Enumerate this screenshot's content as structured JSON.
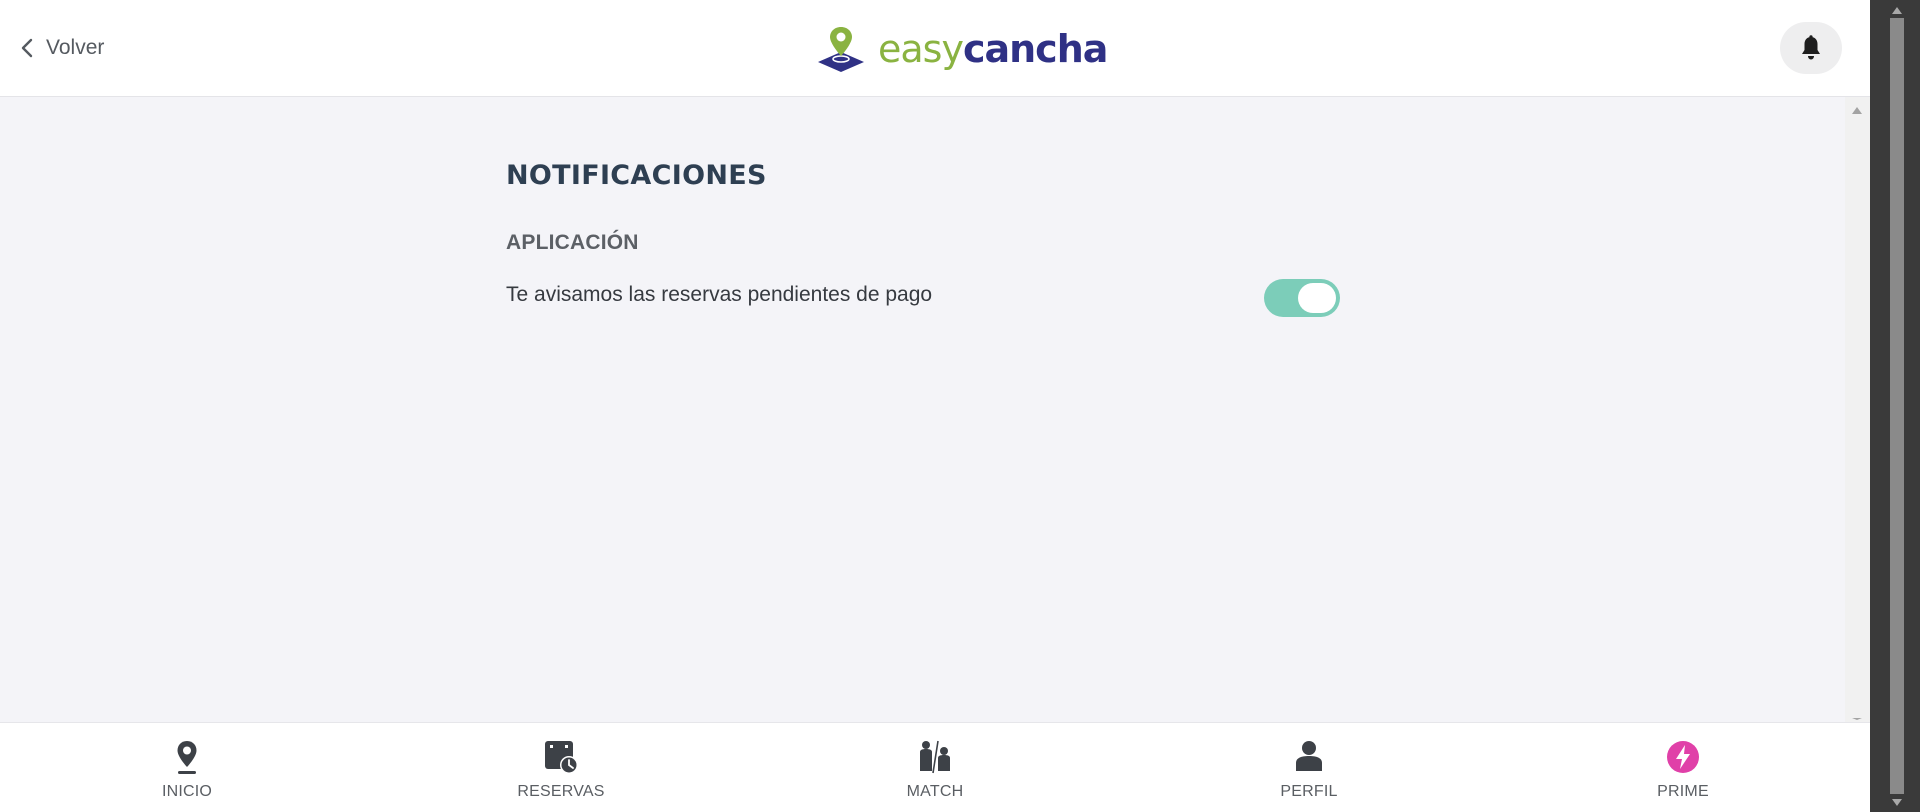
{
  "header": {
    "back_label": "Volver",
    "logo": {
      "easy": "easy",
      "cancha": "cancha",
      "icon": "map-pin-icon"
    },
    "notifications_icon": "bell-icon"
  },
  "main": {
    "title": "NOTIFICACIONES",
    "section_title": "APLICACIÓN",
    "settings": [
      {
        "label": "Te avisamos las reservas pendientes de pago",
        "enabled": true
      }
    ]
  },
  "bottom_nav": {
    "items": [
      {
        "label": "INICIO",
        "icon": "location-pin-icon"
      },
      {
        "label": "RESERVAS",
        "icon": "calendar-clock-icon"
      },
      {
        "label": "MATCH",
        "icon": "players-icon"
      },
      {
        "label": "PERFIL",
        "icon": "user-icon"
      },
      {
        "label": "PRIME",
        "icon": "lightning-icon"
      }
    ]
  },
  "colors": {
    "brand_green": "#8ab341",
    "brand_navy": "#2f3185",
    "toggle_on": "#7ccdb9",
    "prime_accent": "#e040a8",
    "background": "#f4f4f8"
  }
}
